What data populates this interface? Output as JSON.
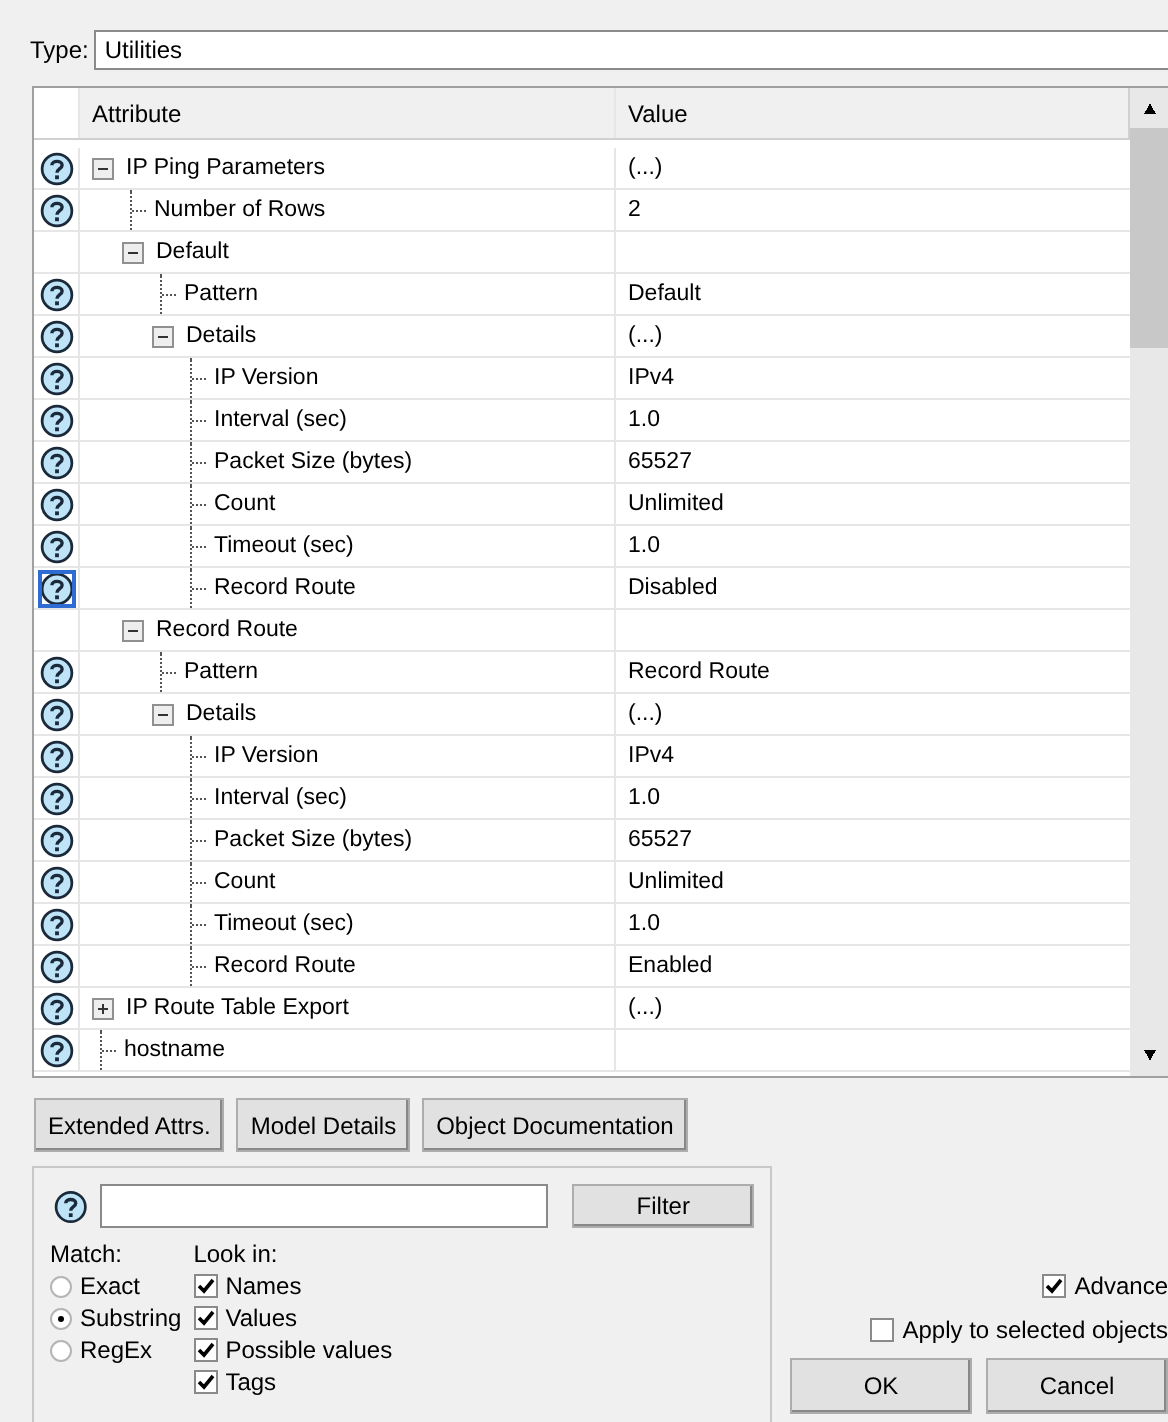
{
  "type_field": {
    "label": "Type:",
    "value": "Utilities"
  },
  "grid": {
    "columns": [
      "Attribute",
      "Value"
    ],
    "rows": [
      {
        "label": "IP Ping Parameters",
        "value": "(...)",
        "help": true,
        "selected": false,
        "expanded": true,
        "children": [
          {
            "label": "Number of Rows",
            "value": "2",
            "help": true,
            "selected": false
          },
          {
            "label": "Default",
            "help": false,
            "selected": false,
            "expanded": true,
            "children": [
              {
                "label": "Pattern",
                "value": "Default",
                "help": true,
                "selected": false
              },
              {
                "label": "Details",
                "value": "(...)",
                "help": true,
                "selected": false,
                "expanded": true,
                "children": [
                  {
                    "label": "IP Version",
                    "value": "IPv4",
                    "help": true,
                    "selected": false
                  },
                  {
                    "label": "Interval (sec)",
                    "value": "1.0",
                    "help": true,
                    "selected": false
                  },
                  {
                    "label": "Packet Size (bytes)",
                    "value": "65527",
                    "help": true,
                    "selected": false
                  },
                  {
                    "label": "Count",
                    "value": "Unlimited",
                    "help": true,
                    "selected": false
                  },
                  {
                    "label": "Timeout (sec)",
                    "value": "1.0",
                    "help": true,
                    "selected": false
                  },
                  {
                    "label": "Record Route",
                    "value": "Disabled",
                    "help": true,
                    "selected": true
                  }
                ]
              }
            ]
          },
          {
            "label": "Record Route",
            "help": false,
            "selected": false,
            "expanded": true,
            "children": [
              {
                "label": "Pattern",
                "value": "Record Route",
                "help": true,
                "selected": false
              },
              {
                "label": "Details",
                "value": "(...)",
                "help": true,
                "selected": false,
                "expanded": true,
                "children": [
                  {
                    "label": "IP Version",
                    "value": "IPv4",
                    "help": true,
                    "selected": false
                  },
                  {
                    "label": "Interval (sec)",
                    "value": "1.0",
                    "help": true,
                    "selected": false
                  },
                  {
                    "label": "Packet Size (bytes)",
                    "value": "65527",
                    "help": true,
                    "selected": false
                  },
                  {
                    "label": "Count",
                    "value": "Unlimited",
                    "help": true,
                    "selected": false
                  },
                  {
                    "label": "Timeout (sec)",
                    "value": "1.0",
                    "help": true,
                    "selected": false
                  },
                  {
                    "label": "Record Route",
                    "value": "Enabled",
                    "help": true,
                    "selected": false
                  }
                ]
              }
            ]
          }
        ]
      },
      {
        "label": "IP Route Table Export",
        "value": "(...)",
        "help": true,
        "selected": false,
        "expanded": false
      },
      {
        "label": "hostname",
        "help": true,
        "selected": false
      }
    ]
  },
  "buttons": [
    "Extended Attrs.",
    "Model Details",
    "Object Documentation"
  ],
  "filter": {
    "button": "Filter",
    "match_label": "Match:",
    "match_options": [
      {
        "label": "Exact",
        "selected": false
      },
      {
        "label": "Substring",
        "selected": true
      },
      {
        "label": "RegEx",
        "selected": false
      }
    ],
    "look_in_label": "Look in:",
    "look_in": [
      {
        "label": "Names",
        "checked": true
      },
      {
        "label": "Values",
        "checked": true
      },
      {
        "label": "Possible values",
        "checked": true
      },
      {
        "label": "Tags",
        "checked": true
      }
    ]
  },
  "options": [
    {
      "label": "Advance",
      "checked": true
    },
    {
      "label": "Apply to selected objects",
      "checked": false
    }
  ],
  "dialog_buttons": [
    "OK",
    "Cancel"
  ]
}
